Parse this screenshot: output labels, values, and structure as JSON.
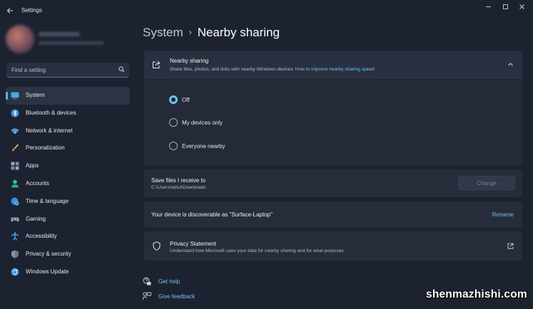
{
  "app": {
    "title": "Settings"
  },
  "sidebar": {
    "search_placeholder": "Find a setting",
    "items": [
      {
        "label": "System",
        "icon": "monitor-icon",
        "active": true
      },
      {
        "label": "Bluetooth & devices",
        "icon": "bluetooth-icon"
      },
      {
        "label": "Network & internet",
        "icon": "wifi-icon"
      },
      {
        "label": "Personalization",
        "icon": "brush-icon"
      },
      {
        "label": "Apps",
        "icon": "apps-grid-icon"
      },
      {
        "label": "Accounts",
        "icon": "person-icon"
      },
      {
        "label": "Time & language",
        "icon": "globe-clock-icon"
      },
      {
        "label": "Gaming",
        "icon": "gamepad-icon"
      },
      {
        "label": "Accessibility",
        "icon": "accessibility-icon"
      },
      {
        "label": "Privacy & security",
        "icon": "shield-icon"
      },
      {
        "label": "Windows Update",
        "icon": "update-icon"
      }
    ]
  },
  "header": {
    "parent": "System",
    "separator": "›",
    "current": "Nearby sharing"
  },
  "nearby": {
    "title": "Nearby sharing",
    "subtitle": "Share files, photos, and links with nearby Windows devices",
    "link": "How to improve nearby sharing speed",
    "options": [
      {
        "label": "Off",
        "checked": true
      },
      {
        "label": "My devices only",
        "checked": false
      },
      {
        "label": "Everyone nearby",
        "checked": false
      }
    ]
  },
  "save": {
    "title": "Save files I receive to",
    "path": "C:\\Users\\rahul\\Downloads",
    "button": "Change"
  },
  "discoverable": {
    "text": "Your device is discoverable as \"Surface-Laptop\"",
    "action": "Rename"
  },
  "privacy": {
    "title": "Privacy Statement",
    "subtitle": "Understand how Microsoft uses your data for nearby sharing and for what purposes"
  },
  "links": {
    "help": "Get help",
    "feedback": "Give feedback"
  },
  "watermark": "shenmazhishi.com",
  "colors": {
    "accent": "#6cc4f5",
    "background": "#1c2230",
    "card": "#262c3a"
  }
}
